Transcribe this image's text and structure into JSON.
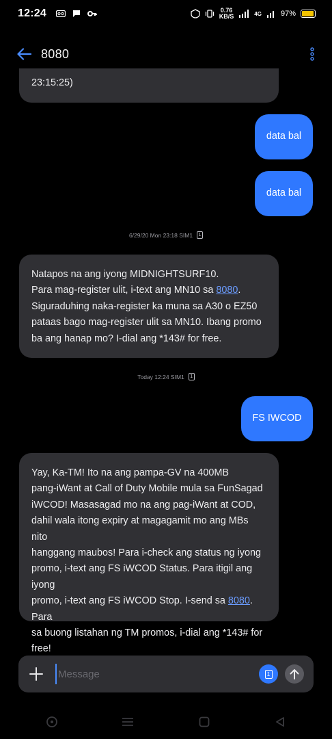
{
  "status_bar": {
    "time": "12:24",
    "speed_value": "0.76",
    "speed_unit": "KB/S",
    "network": "4G",
    "battery": "97%",
    "battery_level": 0.97
  },
  "app_bar": {
    "title": "8080"
  },
  "messages": {
    "m0": {
      "text": "23:15:25)"
    },
    "m1": {
      "text": "data bal"
    },
    "m2": {
      "text": "data bal"
    },
    "ts1": {
      "text": "6/29/20 Mon 23:18  SIM1",
      "sim": "1"
    },
    "m3": {
      "line1": "Natapos na ang iyong MIDNIGHTSURF10.",
      "line2a": "Para mag-register ulit, i-text ang MN10 sa ",
      "link": "8080",
      "line2b": ".",
      "line3": "Siguraduhing naka-register ka muna sa A30 o EZ50",
      "line4": "pataas bago mag-register ulit sa MN10. Ibang promo",
      "line5": "ba ang hanap mo? I-dial ang  *143# for free."
    },
    "ts2": {
      "text": "Today 12:24  SIM1",
      "sim": "1"
    },
    "m4": {
      "text": "FS IWCOD"
    },
    "m5": {
      "line1": "Yay, Ka-TM! Ito na ang pampa-GV na 400MB",
      "line2": "pang-iWant at Call of Duty Mobile mula sa FunSagad",
      "line3": "iWCOD! Masasagad mo na ang pag-iWant at COD,",
      "line4": "dahil wala itong expiry at magagamit mo ang MBs nito",
      "line5": "hanggang maubos! Para i-check ang status ng iyong",
      "line6": "promo, i-text ang FS iWCOD Status. Para itigil ang iyong",
      "line7a": "promo, i-text ang FS iWCOD Stop. I-send sa ",
      "link": "8080",
      "line7b": ". Para",
      "line8": "sa buong listahan ng TM promos, i-dial ang *143# for",
      "line9": "free!"
    }
  },
  "compose": {
    "placeholder": "Message",
    "sim_label": "1"
  },
  "colors": {
    "background": "#000000",
    "incoming_bubble": "#303034",
    "outgoing_bubble": "#2f78ff",
    "accent": "#4a8cff",
    "link": "#6b9cff"
  },
  "icons": [
    "back-arrow-icon",
    "more-vert-icon",
    "plus-icon",
    "sim-icon",
    "send-arrow-icon",
    "home-circle-icon",
    "menu-icon",
    "square-icon",
    "back-triangle-icon"
  ]
}
